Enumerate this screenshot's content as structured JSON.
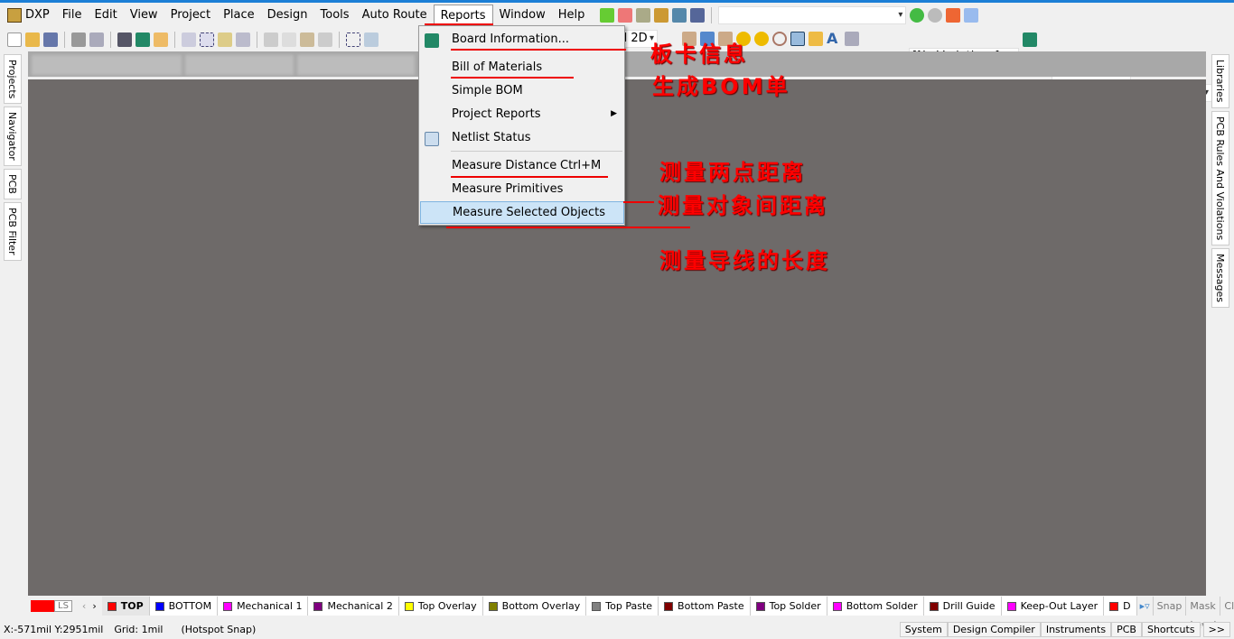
{
  "menubar": {
    "items": [
      "DXP",
      "File",
      "Edit",
      "View",
      "Project",
      "Place",
      "Design",
      "Tools",
      "Auto Route",
      "Reports",
      "Window",
      "Help"
    ],
    "open": "Reports"
  },
  "toolbar": {
    "view_combo": "d 2D",
    "variations": "[No Variations]"
  },
  "left_panels": [
    "Projects",
    "Navigator",
    "PCB",
    "PCB Filter"
  ],
  "right_panels": [
    "Libraries",
    "PCB Rules And Violations",
    "Messages"
  ],
  "reports_menu": {
    "items": [
      {
        "label": "Board Information..."
      },
      {
        "label": "Bill of Materials"
      },
      {
        "label": "Simple BOM"
      },
      {
        "label": "Project Reports",
        "submenu": true
      },
      {
        "label": "Netlist Status"
      },
      {
        "label": "Measure Distance",
        "shortcut": "Ctrl+M"
      },
      {
        "label": "Measure Primitives"
      },
      {
        "label": "Measure Selected Objects",
        "highlighted": true
      }
    ]
  },
  "annotations": [
    "板卡信息",
    "生成BOM单",
    "测量两点距离",
    "测量对象间距离",
    "测量导线的长度"
  ],
  "layers": {
    "current_label": "LS",
    "tabs": [
      {
        "name": "TOP",
        "color": "#ff0000"
      },
      {
        "name": "BOTTOM",
        "color": "#0000ff"
      },
      {
        "name": "Mechanical 1",
        "color": "#ff00ff"
      },
      {
        "name": "Mechanical 2",
        "color": "#800080"
      },
      {
        "name": "Top Overlay",
        "color": "#ffff00"
      },
      {
        "name": "Bottom Overlay",
        "color": "#808000"
      },
      {
        "name": "Top Paste",
        "color": "#808080"
      },
      {
        "name": "Bottom Paste",
        "color": "#800000"
      },
      {
        "name": "Top Solder",
        "color": "#800080"
      },
      {
        "name": "Bottom Solder",
        "color": "#ff00ff"
      },
      {
        "name": "Drill Guide",
        "color": "#800000"
      },
      {
        "name": "Keep-Out Layer",
        "color": "#ff00ff"
      },
      {
        "name": "D",
        "color": "#ff0000"
      }
    ],
    "buttons": [
      "Snap",
      "Mask Level",
      "Clear"
    ]
  },
  "status": {
    "coords": "X:-571mil Y:2951mil",
    "grid": "Grid: 1mil",
    "snap": "(Hotspot Snap)",
    "buttons": [
      "System",
      "Design Compiler",
      "Instruments",
      "PCB",
      "Shortcuts",
      ">>"
    ]
  },
  "colors": {
    "canvas": "#6e6a69",
    "annotation": "#ff0000",
    "highlight": "#cce4f7"
  }
}
